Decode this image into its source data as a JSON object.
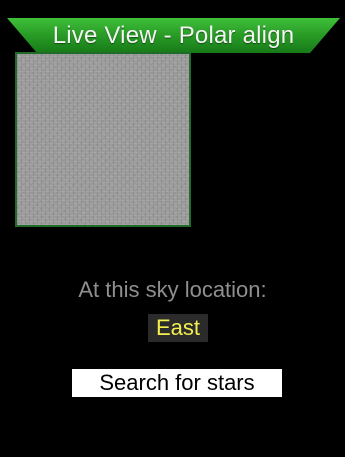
{
  "title": "Live View - Polar align",
  "preview": {
    "border_color": "#1f6b2a"
  },
  "location": {
    "label": "At this sky location:",
    "value": "East",
    "value_color": "#f2ef4f"
  },
  "actions": {
    "search_label": "Search for stars"
  },
  "colors": {
    "background": "#000000",
    "title_bar": "#2a9e27",
    "label_text": "#8f8f8f",
    "button_bg": "#ffffff"
  }
}
